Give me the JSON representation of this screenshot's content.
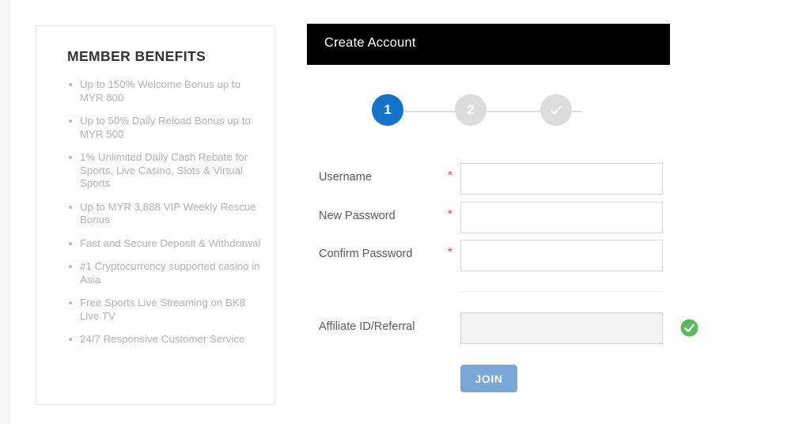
{
  "benefits_panel": {
    "title": "MEMBER BENEFITS",
    "items": [
      "Up to 150% Welcome Bonus up to MYR 800",
      "Up to 50% Daily Reload Bonus up to MYR 500",
      "1% Unlimited Daily Cash Rebate for Sports, Live Casino, Slots & Virtual Sports",
      "Up to MYR 3,888 VIP Weekly Rescue Bonus",
      "Fast and Secure Deposit & Withdrawal",
      "#1 Cryptocurrency supported casino in Asia",
      "Free Sports Live Streaming on BK8 Live TV",
      "24/7 Responsive Customer Service"
    ]
  },
  "form_panel": {
    "header_title": "Create Account",
    "stepper": {
      "steps": [
        {
          "label": "1",
          "state": "active"
        },
        {
          "label": "2",
          "state": "inactive"
        },
        {
          "label": "check-icon",
          "state": "inactive"
        }
      ]
    },
    "fields": [
      {
        "label": "Username",
        "required_marker": "*",
        "value": "",
        "placeholder": ""
      },
      {
        "label": "New Password",
        "required_marker": "*",
        "value": "",
        "placeholder": ""
      },
      {
        "label": "Confirm Password",
        "required_marker": "*",
        "value": "",
        "placeholder": ""
      },
      {
        "label": "Affiliate ID/Referral",
        "required_marker": "",
        "value": "",
        "placeholder": ""
      }
    ],
    "validation_icon": "green-check-icon",
    "submit_label": "JOIN"
  },
  "colors": {
    "header_bar": "#000000",
    "step_active": "#1273c8",
    "step_inactive": "#dcdcdc",
    "required_star": "#e8413c",
    "valid_check": "#5cb85c",
    "join_button": "#7ba7d4",
    "benefit_text": "#b3b3b3"
  }
}
